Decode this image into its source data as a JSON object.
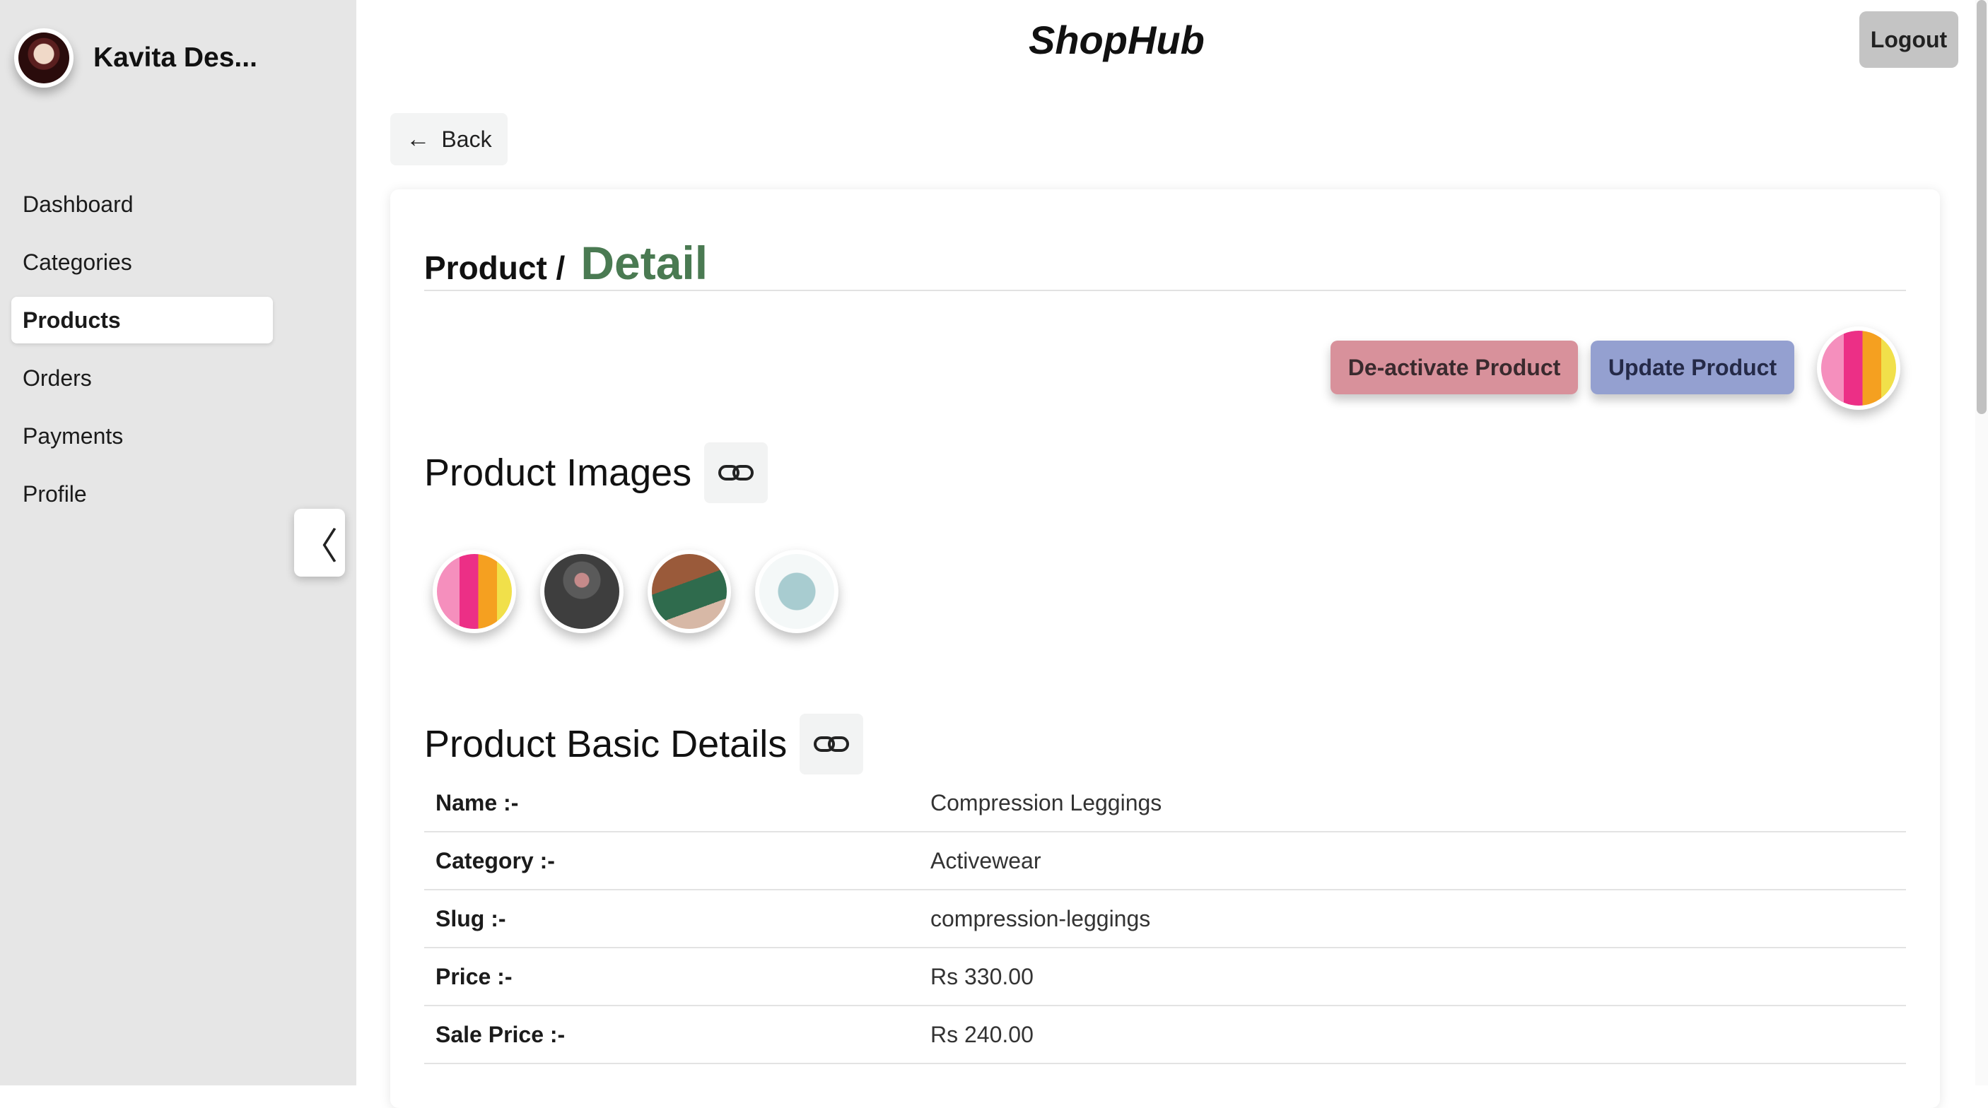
{
  "user": {
    "name": "Kavita Des..."
  },
  "nav": {
    "items": [
      {
        "label": "Dashboard"
      },
      {
        "label": "Categories"
      },
      {
        "label": "Products"
      },
      {
        "label": "Orders"
      },
      {
        "label": "Payments"
      },
      {
        "label": "Profile"
      }
    ],
    "active": "Products",
    "collapse_icon": "chevron-left-icon"
  },
  "header": {
    "brand": "ShopHub",
    "logout_label": "Logout"
  },
  "back": {
    "label": "Back",
    "icon": "arrow-left-icon"
  },
  "page": {
    "breadcrumb": "Product /",
    "title": "Detail",
    "deactivate_label": "De-activate Product",
    "update_label": "Update Product"
  },
  "images_section": {
    "title": "Product Images",
    "icon": "link-icon",
    "count": 4
  },
  "basic_section": {
    "title": "Product Basic Details",
    "icon": "link-icon"
  },
  "details": [
    {
      "label": "Name :-",
      "value": "Compression Leggings"
    },
    {
      "label": "Category :-",
      "value": "Activewear"
    },
    {
      "label": "Slug :-",
      "value": "compression-leggings"
    },
    {
      "label": "Price :-",
      "value": "Rs 330.00"
    },
    {
      "label": "Sale Price :-",
      "value": "Rs 240.00"
    }
  ],
  "colors": {
    "accent_title": "#4a7a52",
    "deactivate_bg": "#d8919b",
    "update_bg": "#94a0d0",
    "sidebar_bg": "#e6e6e6"
  }
}
